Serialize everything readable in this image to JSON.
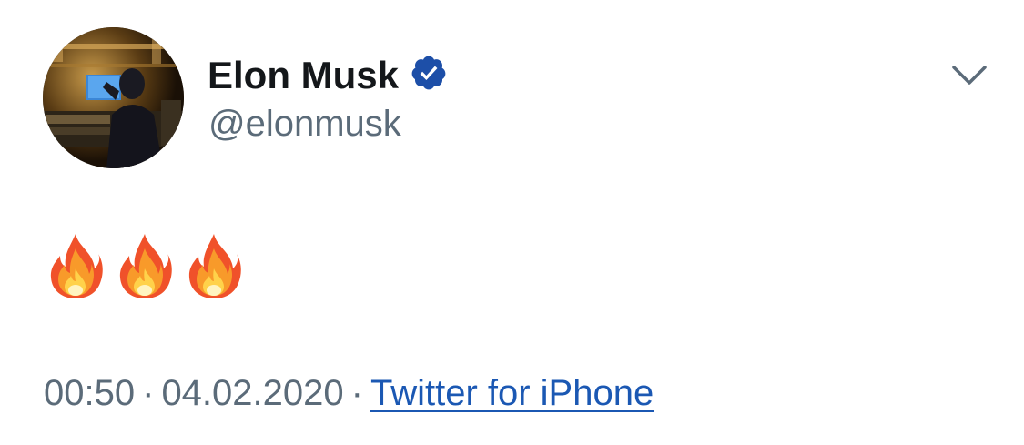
{
  "author": {
    "display_name": "Elon Musk",
    "handle": "@elonmusk",
    "verified": true,
    "avatar_icon": "profile-photo"
  },
  "menu": {
    "icon": "chevron-down-icon"
  },
  "tweet": {
    "text_emojis": [
      "🔥",
      "🔥",
      "🔥"
    ]
  },
  "meta": {
    "time": "00:50",
    "separator": "·",
    "date": "04.02.2020",
    "source": "Twitter for iPhone"
  },
  "colors": {
    "name": "#14171a",
    "secondary_text": "#5b6b79",
    "link": "#1b58b3",
    "verified_badge": "#1d4fa8",
    "background": "#ffffff"
  }
}
